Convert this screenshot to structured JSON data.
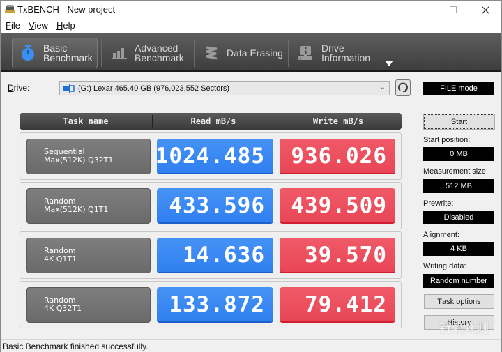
{
  "window": {
    "title": "TxBENCH - New project",
    "minimize_icon": "minimize-icon",
    "maximize_icon": "maximize-icon",
    "close_icon": "close-icon"
  },
  "menu": {
    "items": [
      {
        "label": "File",
        "mnemonic": "F",
        "rest": "ile"
      },
      {
        "label": "View",
        "mnemonic": "V",
        "rest": "iew"
      },
      {
        "label": "Help",
        "mnemonic": "H",
        "rest": "elp"
      }
    ]
  },
  "toolbar": {
    "tabs": [
      {
        "line1": "Basic",
        "line2": "Benchmark",
        "icon": "stopwatch-icon",
        "active": true
      },
      {
        "line1": "Advanced",
        "line2": "Benchmark",
        "icon": "bar-chart-icon",
        "active": false
      },
      {
        "line1": "Data Erasing",
        "line2": "",
        "icon": "eraser-spring-icon",
        "active": false
      },
      {
        "line1": "Drive",
        "line2": "Information",
        "icon": "drive-info-icon",
        "active": false
      }
    ],
    "more_icon": "dropdown-triangle-icon",
    "accent": "#3b8ff2"
  },
  "drive": {
    "label": "Drive:",
    "mnemonic": "D",
    "label_rest": "rive:",
    "selected": "(G:) Lexar  465.40 GB (976,023,552 Sectors)",
    "mode": "FILE mode"
  },
  "table": {
    "headers": [
      "Task name",
      "Read mB/s",
      "Write mB/s"
    ],
    "rows": [
      {
        "task_line1": "Sequential",
        "task_line2": "Max(512K) Q32T1",
        "read": "1024.485",
        "write": "936.026"
      },
      {
        "task_line1": "Random",
        "task_line2": "Max(512K) Q1T1",
        "read": "433.596",
        "write": "439.509"
      },
      {
        "task_line1": "Random",
        "task_line2": "4K Q1T1",
        "read": "14.636",
        "write": "39.570"
      },
      {
        "task_line1": "Random",
        "task_line2": "4K Q32T1",
        "read": "133.872",
        "write": "79.412"
      }
    ],
    "colors": {
      "read": "#3a88f4",
      "write": "#ec4f5e",
      "task": "#747474"
    }
  },
  "side": {
    "start_label": "Start",
    "start_mnemonic": "S",
    "start_rest": "tart",
    "fields": [
      {
        "label": "Start position:",
        "value": "0 MB"
      },
      {
        "label": "Measurement size:",
        "value": "512 MB"
      },
      {
        "label": "Prewrite:",
        "value": "Disabled"
      },
      {
        "label": "Alignment:",
        "value": "4 KB"
      },
      {
        "label": "Writing data:",
        "value": "Random number"
      }
    ],
    "task_options_mnemonic": "T",
    "task_options_rest": "ask options",
    "history_label": "History"
  },
  "status": {
    "text": "Basic Benchmark finished successfully."
  },
  "watermark": {
    "text": "新浪众测"
  }
}
